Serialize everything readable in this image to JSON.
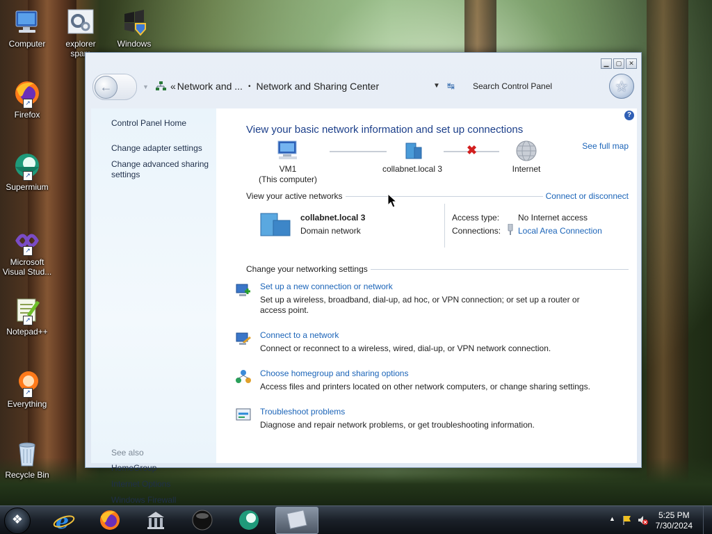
{
  "desktop": {
    "icons": [
      {
        "label": "Computer"
      },
      {
        "label": "explorer spam"
      },
      {
        "label": "Windows"
      },
      {
        "label": "Firefox"
      },
      {
        "label": "Supermium"
      },
      {
        "label": "Microsoft Visual Stud..."
      },
      {
        "label": "Notepad++"
      },
      {
        "label": "Everything"
      },
      {
        "label": "Recycle Bin"
      }
    ]
  },
  "window": {
    "breadcrumb_prefix": "«",
    "breadcrumb_parent": "Network and ...",
    "breadcrumb_separator": "•",
    "breadcrumb_current": "Network and Sharing Center",
    "search_placeholder": "Search Control Panel",
    "help_label": "?"
  },
  "left_pane": {
    "home": "Control Panel Home",
    "links": [
      "Change adapter settings",
      "Change advanced sharing settings"
    ],
    "see_also_title": "See also",
    "see_also": [
      "HomeGroup",
      "Internet Options",
      "Windows Firewall"
    ]
  },
  "main": {
    "heading": "View your basic network information and set up connections",
    "see_full_map": "See full map",
    "map": {
      "computer_name": "VM1",
      "computer_sub": "(This computer)",
      "network": "collabnet.local  3",
      "internet": "Internet"
    },
    "active_networks_title": "View your active networks",
    "connect_or_disconnect": "Connect or disconnect",
    "active_network": {
      "name": "collabnet.local  3",
      "type": "Domain network",
      "access_type_label": "Access type:",
      "access_type_value": "No Internet access",
      "connections_label": "Connections:",
      "connections_value": "Local Area Connection"
    },
    "settings_title": "Change your networking settings",
    "tasks": [
      {
        "title": "Set up a new connection or network",
        "desc": "Set up a wireless, broadband, dial-up, ad hoc, or VPN connection; or set up a router or access point.",
        "icon": "new-connection-icon"
      },
      {
        "title": "Connect to a network",
        "desc": "Connect or reconnect to a wireless, wired, dial-up, or VPN network connection.",
        "icon": "connect-network-icon"
      },
      {
        "title": "Choose homegroup and sharing options",
        "desc": "Access files and printers located on other network computers, or change sharing settings.",
        "icon": "homegroup-icon"
      },
      {
        "title": "Troubleshoot problems",
        "desc": "Diagnose and repair network problems, or get troubleshooting information.",
        "icon": "troubleshoot-icon"
      }
    ]
  },
  "taskbar": {
    "time": "5:25 PM",
    "date": "7/30/2024"
  }
}
